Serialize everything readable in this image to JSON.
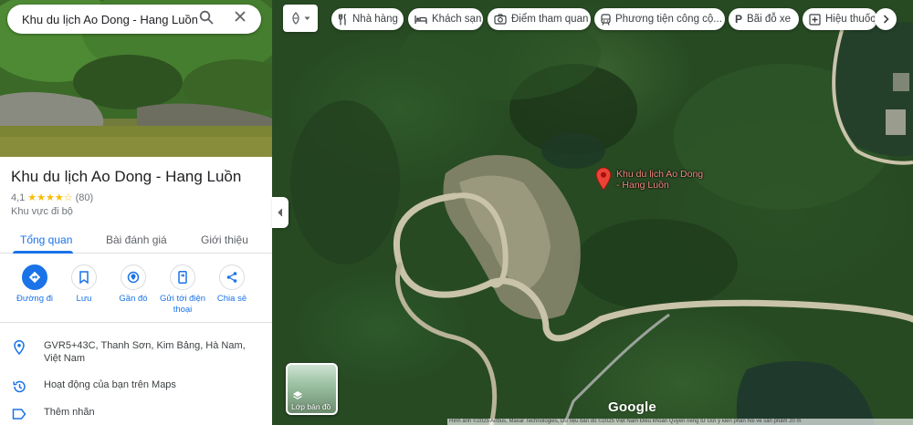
{
  "search": {
    "query": "Khu du lịch Ao Dong - Hang Luồn"
  },
  "place": {
    "title": "Khu du lịch Ao Dong - Hang Luồn",
    "rating": "4,1",
    "stars": "★★★★☆",
    "rating_value": 4.1,
    "review_count": "(80)",
    "category": "Khu vực đi bộ"
  },
  "tabs": [
    {
      "label": "Tổng quan"
    },
    {
      "label": "Bài đánh giá"
    },
    {
      "label": "Giới thiệu"
    }
  ],
  "actions": [
    {
      "label": "Đường đi",
      "icon": "directions-icon"
    },
    {
      "label": "Lưu",
      "icon": "bookmark-icon"
    },
    {
      "label": "Gần đó",
      "icon": "nearby-icon"
    },
    {
      "label": "Gửi tới điện thoại",
      "icon": "send-to-phone-icon"
    },
    {
      "label": "Chia sẻ",
      "icon": "share-icon"
    }
  ],
  "info": {
    "address": "GVR5+43C, Thanh Sơn, Kim Bảng, Hà Nam, Việt Nam",
    "activity": "Hoạt động của bạn trên Maps",
    "add_label": "Thêm nhãn"
  },
  "chips": [
    {
      "label": "Nhà hàng",
      "icon": "restaurant-icon"
    },
    {
      "label": "Khách sạn",
      "icon": "hotel-icon"
    },
    {
      "label": "Điểm tham quan",
      "icon": "camera-icon"
    },
    {
      "label": "Phương tiện công cộ...",
      "icon": "transit-icon"
    },
    {
      "label": "Bãi đỗ xe",
      "icon": "parking-icon"
    },
    {
      "label": "Hiệu thuốc",
      "icon": "pharmacy-icon"
    }
  ],
  "map": {
    "pin_label": "Khu du lịch Ao Dong - Hang Luồn",
    "layers_label": "Lớp bản đồ",
    "logo": "Google",
    "attribution": "Hình ảnh ©2025 Airbus, Maxar Technologies, Dữ liệu bản đồ ©2025   Việt Nam   Điều khoản   Quyền riêng tư   Gửi ý kiến phản hồi về sản phẩm   20 m"
  },
  "colors": {
    "accent": "#1a73e8",
    "star": "#fbbc04",
    "pin": "#ea4335"
  }
}
